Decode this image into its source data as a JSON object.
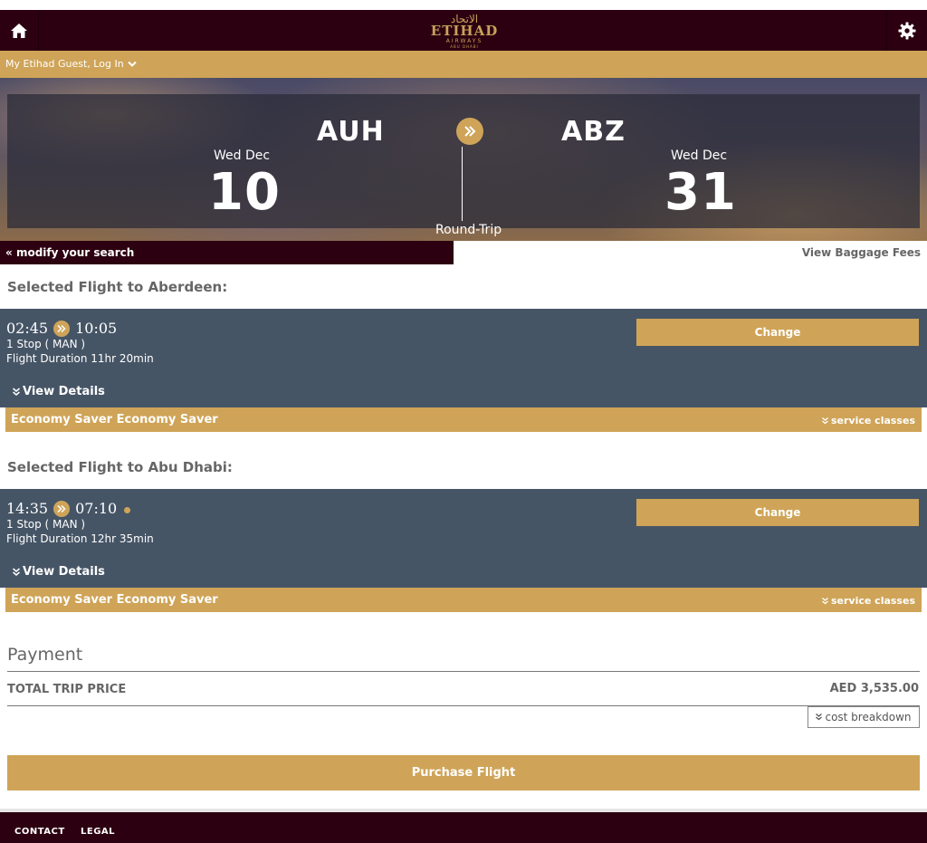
{
  "header": {
    "logo": {
      "arabic": "الاتحاد",
      "brand": "ETIHAD",
      "sub": "AIRWAYS",
      "sub2": "ABU DHABI"
    }
  },
  "member": {
    "label": "My Etihad Guest, Log In"
  },
  "search": {
    "from_code": "AUH",
    "to_code": "ABZ",
    "depart_day": "Wed Dec",
    "depart_date": "10",
    "return_day": "Wed Dec",
    "return_date": "31",
    "trip_type": "Round-Trip",
    "modify_label": "modify your search",
    "baggage_label": "View Baggage Fees"
  },
  "outbound": {
    "title": "Selected Flight to Aberdeen:",
    "depart_time": "02:45",
    "arrive_time": "10:05",
    "stops": "1 Stop ( MAN )",
    "duration": "Flight Duration 11hr 20min",
    "view_details": "View Details",
    "change_label": "Change",
    "class_label": "Economy Saver Economy Saver",
    "service_classes": "service classes"
  },
  "return": {
    "title": "Selected Flight to Abu Dhabi:",
    "depart_time": "14:35",
    "arrive_time": "07:10",
    "stops": "1 Stop ( MAN )",
    "duration": "Flight Duration 12hr 35min",
    "view_details": "View Details",
    "change_label": "Change",
    "class_label": "Economy Saver Economy Saver",
    "service_classes": "service classes"
  },
  "payment": {
    "title": "Payment",
    "total_label": "TOTAL TRIP PRICE",
    "total_value": "AED 3,535.00",
    "breakdown_label": "cost breakdown",
    "purchase_label": "Purchase Flight"
  },
  "footer": {
    "contact": "CONTACT",
    "legal": "LEGAL"
  },
  "colors": {
    "maroon": "#2c0010",
    "gold": "#cfa458",
    "slate": "#465566"
  }
}
